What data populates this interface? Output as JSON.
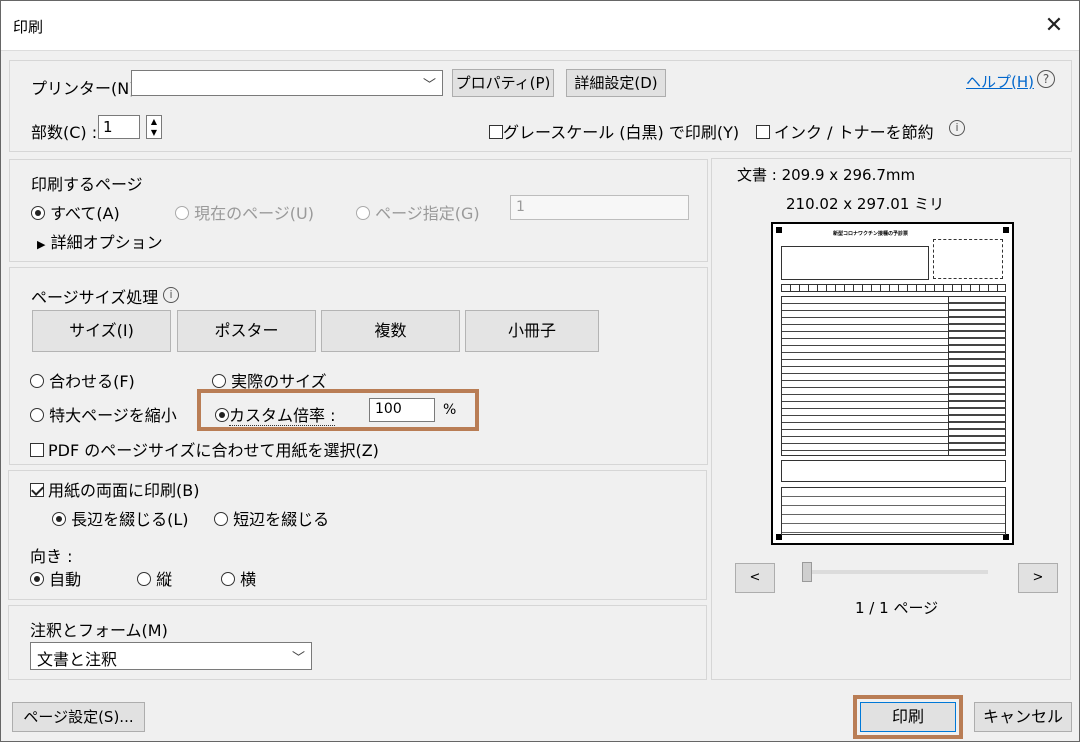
{
  "window": {
    "title": "印刷"
  },
  "printer": {
    "label": "プリンター(N) :",
    "value": "",
    "properties": "プロパティ(P)",
    "advanced": "詳細設定(D)",
    "help": "ヘルプ(H)"
  },
  "copies": {
    "label": "部数(C) :",
    "value": "1"
  },
  "options": {
    "grayscale": "グレースケール (白黒) で印刷(Y)",
    "save_ink": "インク / トナーを節約"
  },
  "pages": {
    "heading": "印刷するページ",
    "all": "すべて(A)",
    "current": "現在のページ(U)",
    "range": "ページ指定(G)",
    "range_value": "1",
    "more": "詳細オプション"
  },
  "sizing": {
    "heading": "ページサイズ処理",
    "tabs": [
      "サイズ(I)",
      "ポスター",
      "複数",
      "小冊子"
    ],
    "fit": "合わせる(F)",
    "actual": "実際のサイズ",
    "shrink": "特大ページを縮小",
    "custom": "カスタム倍率 :",
    "custom_value": "100",
    "percent": "%",
    "pdf_paper": "PDF のページサイズに合わせて用紙を選択(Z)"
  },
  "duplex": {
    "label": "用紙の両面に印刷(B)",
    "long": "長辺を綴じる(L)",
    "short": "短辺を綴じる"
  },
  "orientation": {
    "label": "向き :",
    "auto": "自動",
    "portrait": "縦",
    "landscape": "横"
  },
  "comments": {
    "label": "注釈とフォーム(M)",
    "value": "文書と注釈"
  },
  "preview": {
    "doc_size": "文書 : 209.9 x 296.7mm",
    "paper_size": "210.02 x 297.01 ミリ",
    "page_counter": "1 / 1 ページ",
    "doc_title": "新型コロナワクチン接種の予診票"
  },
  "footer": {
    "page_setup": "ページ設定(S)...",
    "print": "印刷",
    "cancel": "キャンセル"
  },
  "colors": {
    "highlight": "#b97d55",
    "link": "#0066cc"
  }
}
